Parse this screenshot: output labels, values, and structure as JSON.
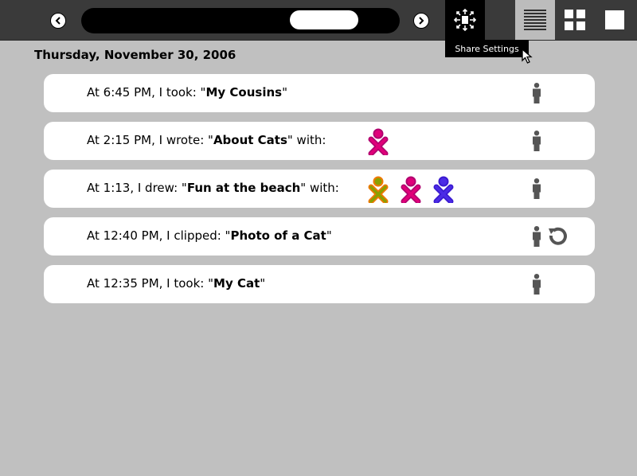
{
  "toolbar": {
    "back_icon": "chevron-left-icon",
    "forward_icon": "chevron-right-icon",
    "share_icon": "share-settings-icon",
    "views": [
      "list-view-icon",
      "grid-view-icon",
      "single-view-icon"
    ]
  },
  "tooltip": "Share Settings",
  "date_heading": "Thursday, November 30, 2006",
  "colors": {
    "toolbar_bg": "#3a3a3a",
    "page_bg": "#c0c0c0",
    "entry_bg": "#ffffff",
    "person_icon": "#555555"
  },
  "entries": [
    {
      "prefix": "At 6:45 PM, I took: \"",
      "title": "My Cousins",
      "suffix": "\"",
      "buddies": []
    },
    {
      "prefix": "At 2:15 PM, I wrote: \"",
      "title": "About Cats",
      "suffix": "\" with:",
      "buddies": [
        {
          "stroke": "#b0006e",
          "fill": "#e0007a"
        }
      ]
    },
    {
      "prefix": "At 1:13, I drew: \"",
      "title": "Fun at the beach",
      "suffix": "\" with:",
      "buddies": [
        {
          "stroke": "#f07800",
          "fill": "#8ba000"
        },
        {
          "stroke": "#b0006e",
          "fill": "#e0007a"
        },
        {
          "stroke": "#3a1ad0",
          "fill": "#4b2be6"
        }
      ]
    },
    {
      "prefix": "At 12:40 PM, I clipped: \"",
      "title": "Photo of a Cat",
      "suffix": "\"",
      "buddies": [],
      "resume": true
    },
    {
      "prefix": "At 12:35 PM, I took: \"",
      "title": "My Cat",
      "suffix": "\"",
      "buddies": []
    }
  ]
}
